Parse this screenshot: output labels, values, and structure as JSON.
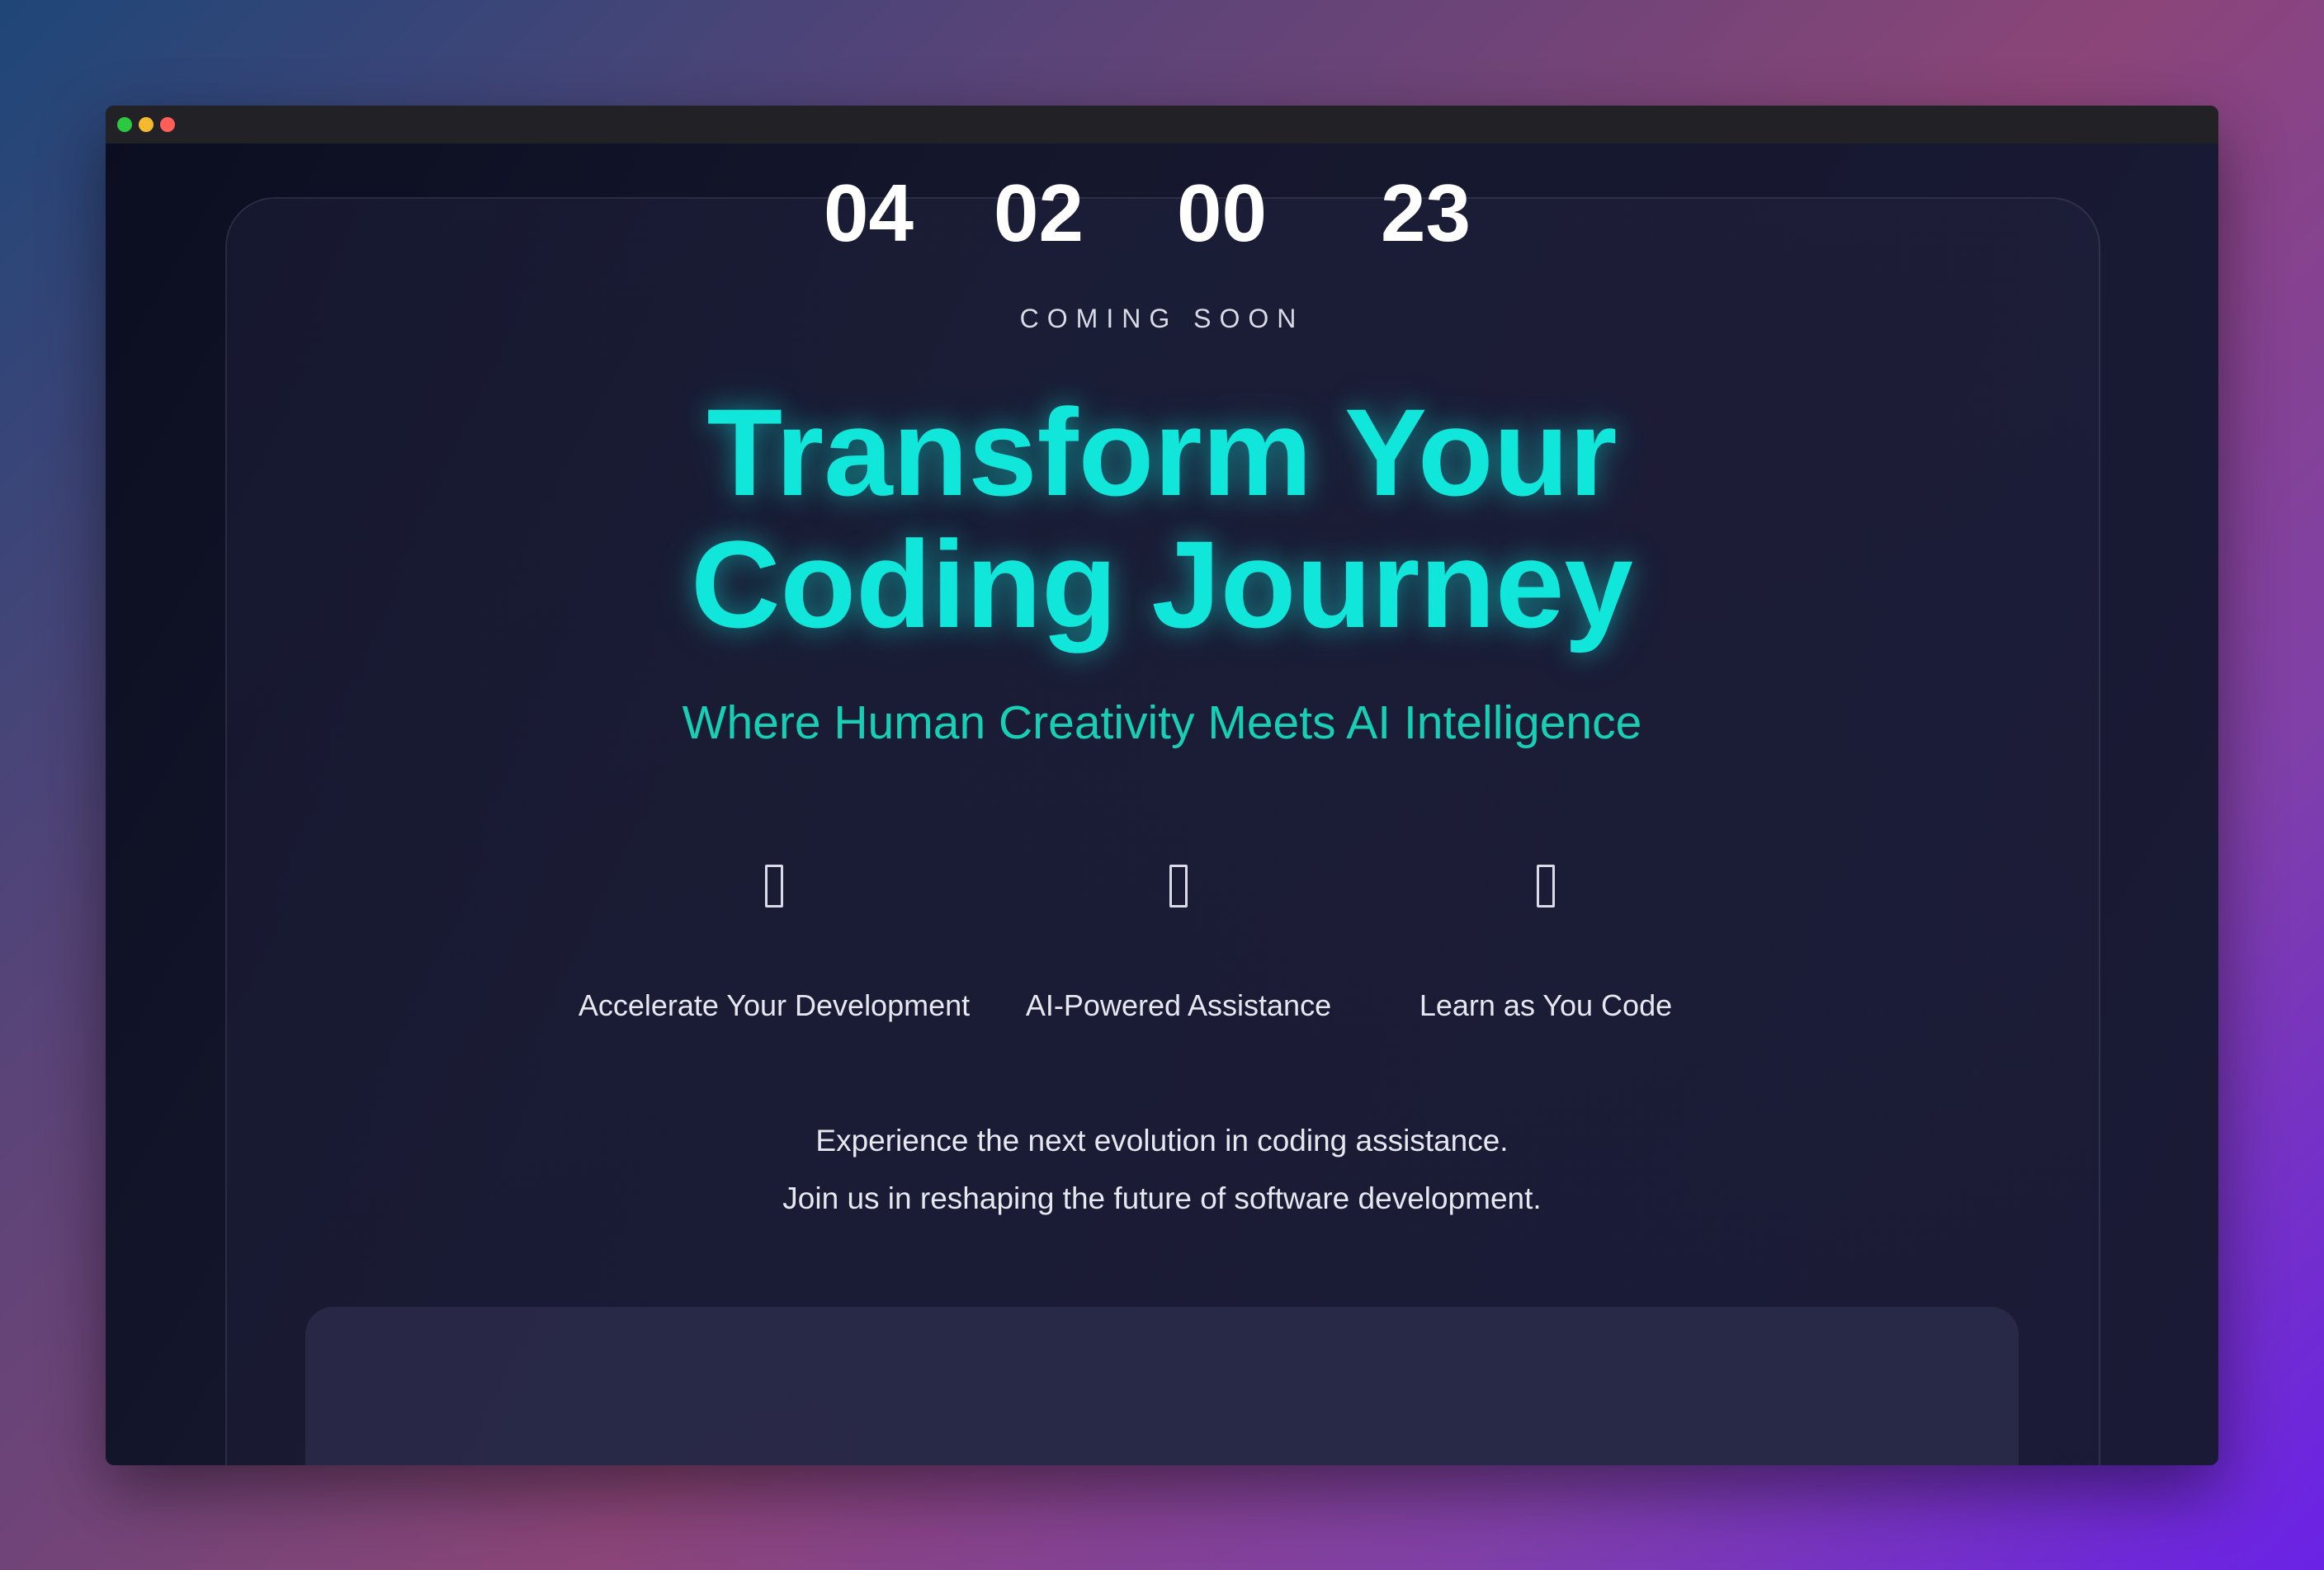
{
  "window": {
    "controls": [
      {
        "name": "maximize",
        "color": "#2bc840"
      },
      {
        "name": "minimize",
        "color": "#f5b82e"
      },
      {
        "name": "close",
        "color": "#ff5f57"
      }
    ]
  },
  "hero": {
    "eyebrow": "COMING SOON",
    "title_line1": "Transform Your",
    "title_line2": "Coding Journey",
    "subtitle": "Where Human Creativity Meets AI Intelligence",
    "accent_color": "#10e6da"
  },
  "features": [
    {
      "icon": "rocket-icon",
      "label": "Accelerate Your Development"
    },
    {
      "icon": "robot-icon",
      "label": "AI-Powered Assistance"
    },
    {
      "icon": "book-icon",
      "label": "Learn as You Code"
    }
  ],
  "description": {
    "line1": "Experience the next evolution in coding assistance.",
    "line2": "Join us in reshaping the future of software development."
  },
  "countdown": {
    "days": "04",
    "hours": "02",
    "minutes": "00",
    "seconds": "23"
  }
}
